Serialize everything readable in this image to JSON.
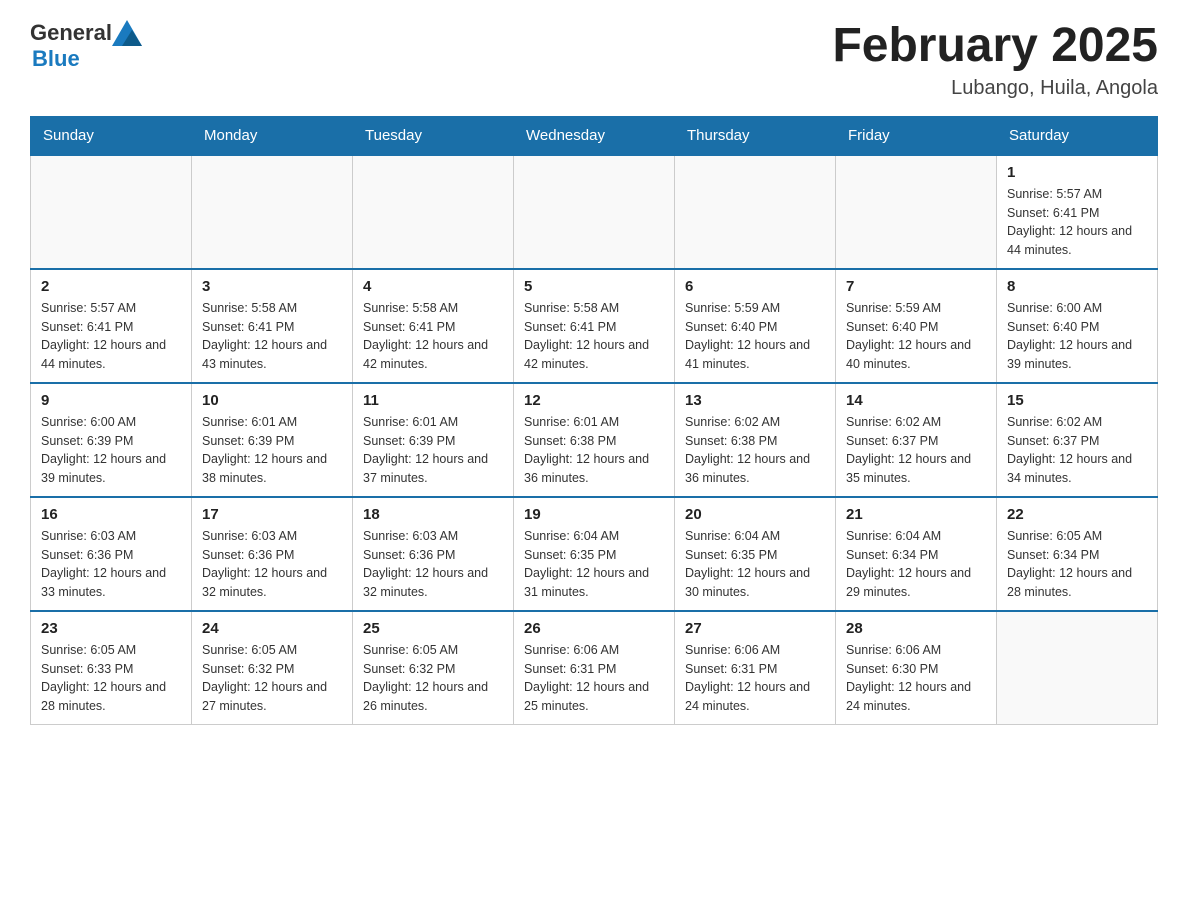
{
  "logo": {
    "general": "General",
    "blue": "Blue"
  },
  "header": {
    "month": "February 2025",
    "location": "Lubango, Huila, Angola"
  },
  "weekdays": [
    "Sunday",
    "Monday",
    "Tuesday",
    "Wednesday",
    "Thursday",
    "Friday",
    "Saturday"
  ],
  "weeks": [
    [
      {
        "day": "",
        "info": ""
      },
      {
        "day": "",
        "info": ""
      },
      {
        "day": "",
        "info": ""
      },
      {
        "day": "",
        "info": ""
      },
      {
        "day": "",
        "info": ""
      },
      {
        "day": "",
        "info": ""
      },
      {
        "day": "1",
        "info": "Sunrise: 5:57 AM\nSunset: 6:41 PM\nDaylight: 12 hours\nand 44 minutes."
      }
    ],
    [
      {
        "day": "2",
        "info": "Sunrise: 5:57 AM\nSunset: 6:41 PM\nDaylight: 12 hours\nand 44 minutes."
      },
      {
        "day": "3",
        "info": "Sunrise: 5:58 AM\nSunset: 6:41 PM\nDaylight: 12 hours\nand 43 minutes."
      },
      {
        "day": "4",
        "info": "Sunrise: 5:58 AM\nSunset: 6:41 PM\nDaylight: 12 hours\nand 42 minutes."
      },
      {
        "day": "5",
        "info": "Sunrise: 5:58 AM\nSunset: 6:41 PM\nDaylight: 12 hours\nand 42 minutes."
      },
      {
        "day": "6",
        "info": "Sunrise: 5:59 AM\nSunset: 6:40 PM\nDaylight: 12 hours\nand 41 minutes."
      },
      {
        "day": "7",
        "info": "Sunrise: 5:59 AM\nSunset: 6:40 PM\nDaylight: 12 hours\nand 40 minutes."
      },
      {
        "day": "8",
        "info": "Sunrise: 6:00 AM\nSunset: 6:40 PM\nDaylight: 12 hours\nand 39 minutes."
      }
    ],
    [
      {
        "day": "9",
        "info": "Sunrise: 6:00 AM\nSunset: 6:39 PM\nDaylight: 12 hours\nand 39 minutes."
      },
      {
        "day": "10",
        "info": "Sunrise: 6:01 AM\nSunset: 6:39 PM\nDaylight: 12 hours\nand 38 minutes."
      },
      {
        "day": "11",
        "info": "Sunrise: 6:01 AM\nSunset: 6:39 PM\nDaylight: 12 hours\nand 37 minutes."
      },
      {
        "day": "12",
        "info": "Sunrise: 6:01 AM\nSunset: 6:38 PM\nDaylight: 12 hours\nand 36 minutes."
      },
      {
        "day": "13",
        "info": "Sunrise: 6:02 AM\nSunset: 6:38 PM\nDaylight: 12 hours\nand 36 minutes."
      },
      {
        "day": "14",
        "info": "Sunrise: 6:02 AM\nSunset: 6:37 PM\nDaylight: 12 hours\nand 35 minutes."
      },
      {
        "day": "15",
        "info": "Sunrise: 6:02 AM\nSunset: 6:37 PM\nDaylight: 12 hours\nand 34 minutes."
      }
    ],
    [
      {
        "day": "16",
        "info": "Sunrise: 6:03 AM\nSunset: 6:36 PM\nDaylight: 12 hours\nand 33 minutes."
      },
      {
        "day": "17",
        "info": "Sunrise: 6:03 AM\nSunset: 6:36 PM\nDaylight: 12 hours\nand 32 minutes."
      },
      {
        "day": "18",
        "info": "Sunrise: 6:03 AM\nSunset: 6:36 PM\nDaylight: 12 hours\nand 32 minutes."
      },
      {
        "day": "19",
        "info": "Sunrise: 6:04 AM\nSunset: 6:35 PM\nDaylight: 12 hours\nand 31 minutes."
      },
      {
        "day": "20",
        "info": "Sunrise: 6:04 AM\nSunset: 6:35 PM\nDaylight: 12 hours\nand 30 minutes."
      },
      {
        "day": "21",
        "info": "Sunrise: 6:04 AM\nSunset: 6:34 PM\nDaylight: 12 hours\nand 29 minutes."
      },
      {
        "day": "22",
        "info": "Sunrise: 6:05 AM\nSunset: 6:34 PM\nDaylight: 12 hours\nand 28 minutes."
      }
    ],
    [
      {
        "day": "23",
        "info": "Sunrise: 6:05 AM\nSunset: 6:33 PM\nDaylight: 12 hours\nand 28 minutes."
      },
      {
        "day": "24",
        "info": "Sunrise: 6:05 AM\nSunset: 6:32 PM\nDaylight: 12 hours\nand 27 minutes."
      },
      {
        "day": "25",
        "info": "Sunrise: 6:05 AM\nSunset: 6:32 PM\nDaylight: 12 hours\nand 26 minutes."
      },
      {
        "day": "26",
        "info": "Sunrise: 6:06 AM\nSunset: 6:31 PM\nDaylight: 12 hours\nand 25 minutes."
      },
      {
        "day": "27",
        "info": "Sunrise: 6:06 AM\nSunset: 6:31 PM\nDaylight: 12 hours\nand 24 minutes."
      },
      {
        "day": "28",
        "info": "Sunrise: 6:06 AM\nSunset: 6:30 PM\nDaylight: 12 hours\nand 24 minutes."
      },
      {
        "day": "",
        "info": ""
      }
    ]
  ]
}
